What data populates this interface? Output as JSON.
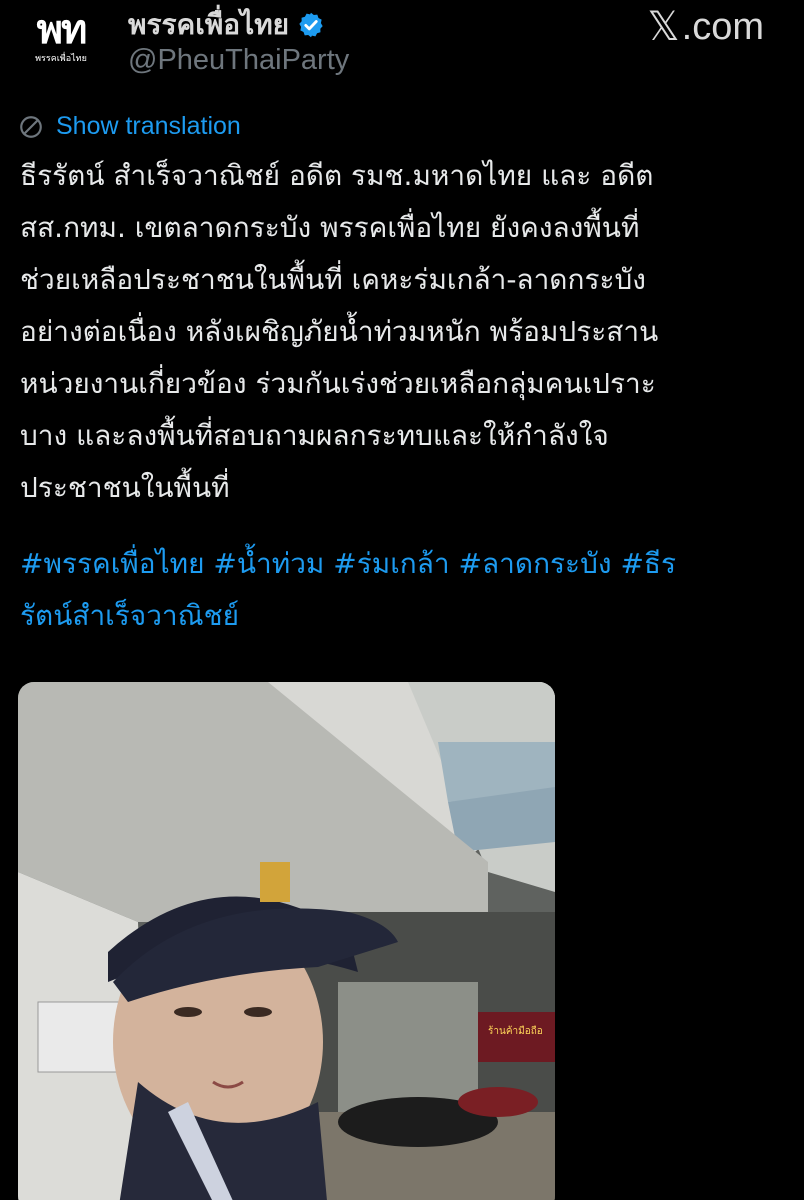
{
  "header": {
    "avatar_logo_text": "พท",
    "avatar_logo_subtext": "พรรคเพื่อไทย",
    "display_name": "พรรคเพื่อไทย",
    "verified_icon": "verified-badge-icon",
    "handle": "@PheuThaiParty",
    "site_logo_glyph": "𝕏",
    "site_logo_text": ".com"
  },
  "translation": {
    "icon": "globe-icon",
    "label": "Show translation"
  },
  "post": {
    "lines": [
      "ธีรรัตน์ สำเร็จวาณิชย์ อดีต รมช.มหาดไทย และ อดีต",
      "สส.กทม. เขตลาดกระบัง พรรคเพื่อไทย ยังคงลงพื้นที่",
      "ช่วยเหลือประชาชนในพื้นที่ เคหะร่มเกล้า-ลาดกระบัง",
      "อย่างต่อเนื่อง หลังเผชิญภัยน้ำท่วมหนัก พร้อมประสาน",
      "หน่วยงานเกี่ยวข้อง ร่วมกันเร่งช่วยเหลือกลุ่มคนเปราะ",
      "บาง และลงพื้นที่สอบถามผลกระทบและให้กำลังใจ",
      "ประชาชนในพื้นที่"
    ],
    "hashtag_lines": [
      "#พรรคเพื่อไทย #น้ำท่วม #ร่มเกล้า #ลาดกระบัง #ธีร",
      "รัตน์สำเร็จวาณิชย์"
    ]
  },
  "media": {
    "shop_sign_text": "ร้านค้ามือถือ"
  },
  "colors": {
    "background": "#000000",
    "text": "#e7e9ea",
    "link": "#1d9bf0",
    "muted": "#6e767d"
  }
}
